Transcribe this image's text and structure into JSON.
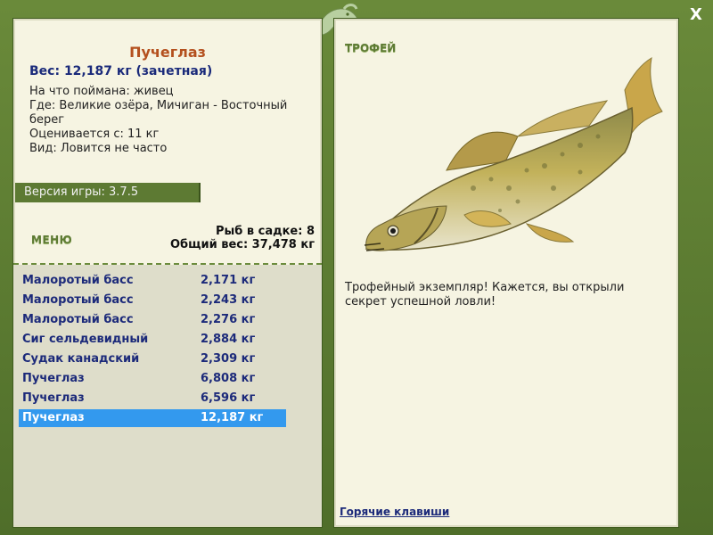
{
  "close_label": "X",
  "fish": {
    "title": "Пучеглаз",
    "weight": "Вес: 12,187 кг (зачетная)",
    "details": [
      "На что поймана: живец",
      "Где: Великие озёра, Мичиган - Восточный берег",
      "Оценивается с: 11 кг",
      "Вид: Ловится не часто"
    ]
  },
  "version": "Версия игры: 3.7.5",
  "menu": {
    "title": "МЕНЮ",
    "count": "Рыб в садке: 8",
    "total": "Общий вес: 37,478 кг"
  },
  "catches": [
    {
      "name": "Малоротый басс",
      "weight": "2,171 кг"
    },
    {
      "name": "Малоротый басс",
      "weight": "2,243 кг"
    },
    {
      "name": "Малоротый басс",
      "weight": "2,276 кг"
    },
    {
      "name": "Сиг сельдевидный",
      "weight": "2,884 кг"
    },
    {
      "name": "Судак канадский",
      "weight": "2,309 кг"
    },
    {
      "name": "Пучеглаз",
      "weight": "6,808 кг"
    },
    {
      "name": "Пучеглаз",
      "weight": "6,596 кг"
    },
    {
      "name": "Пучеглаз",
      "weight": "12,187 кг"
    }
  ],
  "selected_index": 7,
  "trophy": {
    "title": "ТРОФЕЙ",
    "text": "Трофейный экземпляр! Кажется, вы открыли секрет успешной ловли!",
    "image_icon": "walleye-fish-illustration"
  },
  "hotkeys": "Горячие клавиши",
  "colors": {
    "frame": "#5a7a30",
    "panel": "#f6f4e2",
    "catch_text": "#1c2a7a",
    "selected": "#3399ee",
    "title_orange": "#b4501e"
  }
}
